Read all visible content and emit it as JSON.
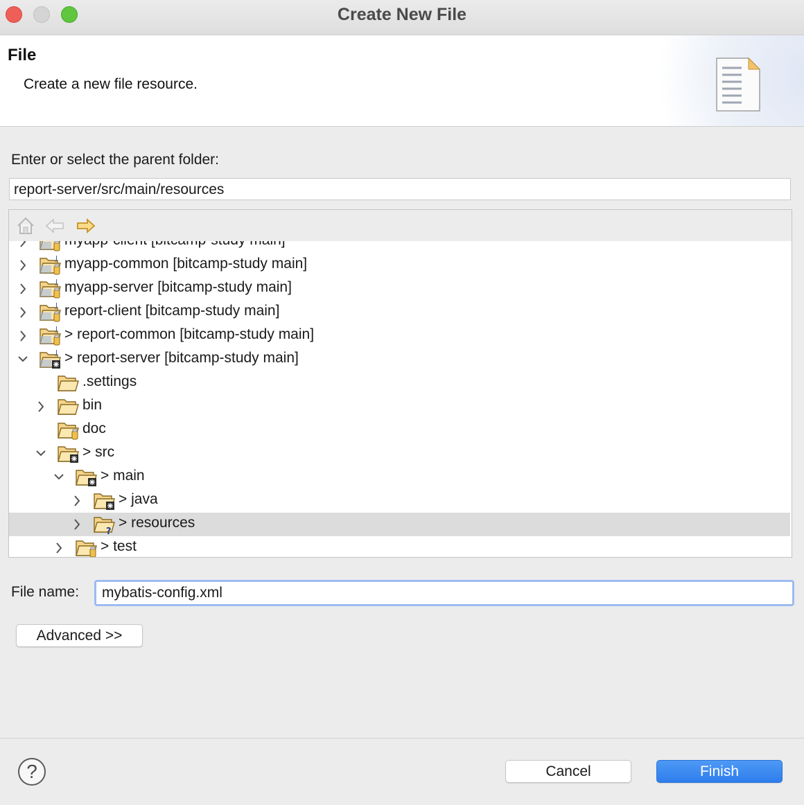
{
  "window": {
    "title": "Create New File"
  },
  "banner": {
    "title": "File",
    "description": "Create a new file resource.",
    "icon": "document-icon"
  },
  "parent_folder": {
    "label": "Enter or select the parent folder:",
    "value": "report-server/src/main/resources"
  },
  "toolbar": {
    "icons": [
      "home-icon",
      "back-arrow-icon",
      "forward-arrow-icon"
    ]
  },
  "tree": {
    "rows": [
      {
        "label": "myapp-client [bitcamp-study main]",
        "expanded": false,
        "icon": "project-icon"
      },
      {
        "label": "myapp-common [bitcamp-study main]",
        "expanded": false,
        "icon": "project-icon"
      },
      {
        "label": "myapp-server [bitcamp-study main]",
        "expanded": false,
        "icon": "project-icon"
      },
      {
        "label": "report-client [bitcamp-study main]",
        "expanded": false,
        "icon": "project-icon"
      },
      {
        "label": "> report-common [bitcamp-study main]",
        "expanded": false,
        "icon": "project-icon"
      },
      {
        "label": "> report-server [bitcamp-study main]",
        "expanded": true,
        "icon": "project-icon"
      },
      {
        "label": ".settings",
        "icon": "folder-icon"
      },
      {
        "label": "bin",
        "expanded": false,
        "icon": "folder-icon"
      },
      {
        "label": "doc",
        "icon": "folder-icon"
      },
      {
        "label": "> src",
        "expanded": true,
        "icon": "folder-icon"
      },
      {
        "label": "> main",
        "expanded": true,
        "icon": "folder-icon"
      },
      {
        "label": "> java",
        "expanded": false,
        "icon": "folder-icon"
      },
      {
        "label": "> resources",
        "expanded": false,
        "selected": true,
        "icon": "folder-icon"
      },
      {
        "label": "> test",
        "expanded": false,
        "icon": "folder-icon"
      }
    ]
  },
  "file_name": {
    "label": "File name:",
    "value": "mybatis-config.xml"
  },
  "buttons": {
    "advanced": "Advanced >>",
    "cancel": "Cancel",
    "finish": "Finish"
  },
  "help": {
    "glyph": "?"
  },
  "colors": {
    "accent": "#2f7fee",
    "selection": "#dcdcdc",
    "folder": "#f5d38a"
  }
}
